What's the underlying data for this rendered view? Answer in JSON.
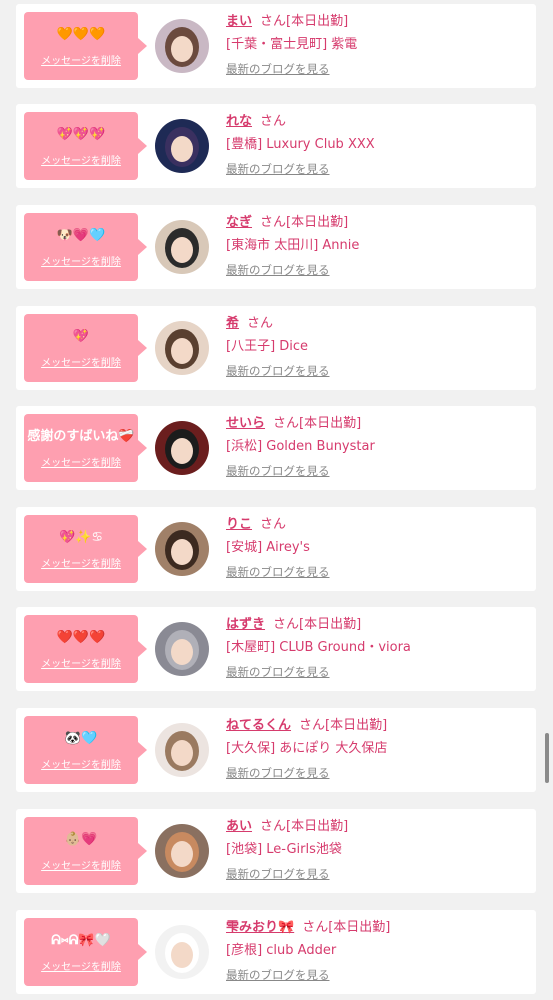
{
  "delete_label": "メッセージを削除",
  "honorific": "さん",
  "blog_label": "最新のブログを見る",
  "items": [
    {
      "message": "🧡🧡🧡",
      "name": "まい",
      "status": "[本日出勤]",
      "shop": "[千葉・富士見町] 紫電",
      "avatar_color": "#c9b8c4",
      "avatar_hair": "#6b4a3e"
    },
    {
      "message": "💖💖💖",
      "name": "れな",
      "status": "",
      "shop": "[豊橋] Luxury Club XXX",
      "avatar_color": "#1e2a55",
      "avatar_hair": "#3a3060"
    },
    {
      "message": "🐶💗🩵",
      "name": "なぎ",
      "status": "[本日出勤]",
      "shop": "[東海市 太田川] Annie",
      "avatar_color": "#d8c8b8",
      "avatar_hair": "#2b2b2b"
    },
    {
      "message": "💖",
      "name": "希",
      "status": "",
      "shop": "[八王子] Dice",
      "avatar_color": "#e6d4c6",
      "avatar_hair": "#5a4030"
    },
    {
      "message": "感謝のすばいね❤️‍🩹",
      "name": "せいら",
      "status": "[本日出勤]",
      "shop": "[浜松] Golden Bunystar",
      "avatar_color": "#6b1e1e",
      "avatar_hair": "#1c1c1c"
    },
    {
      "message": "💖✨♋",
      "name": "りこ",
      "status": "",
      "shop": "[安城] Airey's",
      "avatar_color": "#a08068",
      "avatar_hair": "#3c2a20"
    },
    {
      "message": "❤️❤️❤️",
      "name": "はずき",
      "status": "[本日出勤]",
      "shop": "[木屋町] CLUB Ground・viora",
      "avatar_color": "#8a8a94",
      "avatar_hair": "#b0b0b8"
    },
    {
      "message": "🐼🩵",
      "name": "ねてるくん",
      "status": "[本日出勤]",
      "shop": "[大久保] あにぽり 大久保店",
      "avatar_color": "#ece4e0",
      "avatar_hair": "#9a7a60"
    },
    {
      "message": "👶🏼💗",
      "name": "あい",
      "status": "[本日出勤]",
      "shop": "[池袋] Le-Girls池袋",
      "avatar_color": "#8a7060",
      "avatar_hair": "#c88a60"
    },
    {
      "message": "ᕱ⑅ᕱ🎀🤍",
      "name": "雫みおり🎀",
      "status": "[本日出勤]",
      "shop": "[彦根] club Adder",
      "avatar_color": "#f2f2f2",
      "avatar_hair": "#ffffff"
    }
  ]
}
